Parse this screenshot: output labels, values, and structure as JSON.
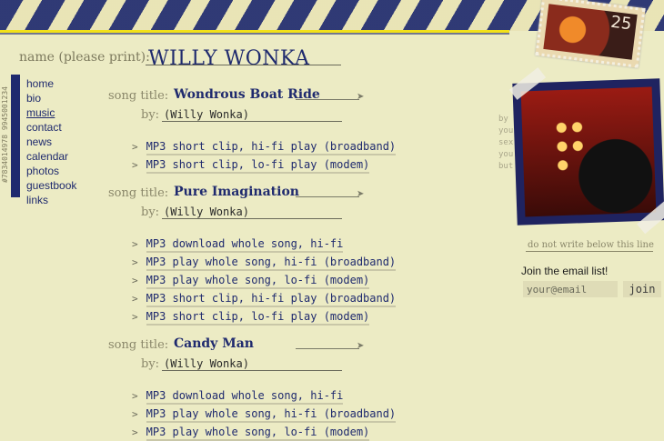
{
  "header": {
    "name_label": "name (please print):",
    "name_value": "WILLY WONKA",
    "stamp_number": "25"
  },
  "side_code": "#7834014978 9945001234",
  "nav": {
    "items": [
      {
        "label": "home"
      },
      {
        "label": "bio"
      },
      {
        "label": "music",
        "current": true
      },
      {
        "label": "contact"
      },
      {
        "label": "news"
      },
      {
        "label": "calendar"
      },
      {
        "label": "photos"
      },
      {
        "label": "guestbook"
      },
      {
        "label": "links"
      }
    ]
  },
  "songs": [
    {
      "title_label": "song title:",
      "title": "Wondrous Boat Ride",
      "by_label": "by:",
      "by_value": "(Willy Wonka)",
      "links": [
        "MP3 short clip, hi-fi play (broadband)",
        "MP3 short clip, lo-fi play (modem)"
      ]
    },
    {
      "title_label": "song title:",
      "title": "Pure Imagination",
      "by_label": "by:",
      "by_value": "(Willy Wonka)",
      "links": [
        "MP3 download whole song, hi-fi",
        "MP3 play whole song, hi-fi (broadband)",
        "MP3 play whole song, lo-fi (modem)",
        "MP3 short clip, hi-fi play (broadband)",
        "MP3 short clip, lo-fi play (modem)"
      ]
    },
    {
      "title_label": "song title:",
      "title": "Candy Man",
      "by_label": "by:",
      "by_value": "(Willy Wonka)",
      "links": [
        "MP3 download whole song, hi-fi",
        "MP3 play whole song, hi-fi (broadband)",
        "MP3 play whole song, lo-fi (modem)"
      ]
    }
  ],
  "link_marker": ">",
  "sidebar": {
    "do_not_write": "do not write below this line",
    "edge_text": [
      "by",
      "you",
      "sex",
      "you",
      "but"
    ],
    "email": {
      "heading": "Join the email list!",
      "placeholder": "your@email",
      "button_label": "join"
    }
  },
  "colors": {
    "accent": "#1f2a6e",
    "background": "#ecebc4",
    "stripe_yellow": "#f2e11a"
  }
}
